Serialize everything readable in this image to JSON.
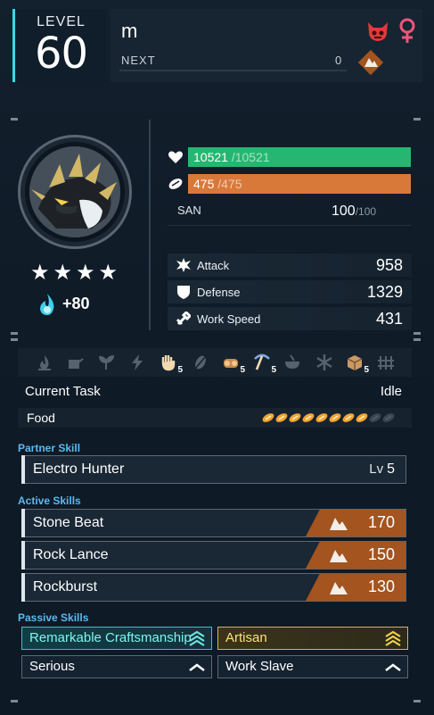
{
  "header": {
    "level_label": "LEVEL",
    "level_value": "60",
    "pal_name": "m",
    "next_label": "NEXT",
    "next_value": "0",
    "boss_icon": "boss-mask-icon",
    "gender_icon": "female-icon",
    "element_icon": "ground-element-icon",
    "accent_color": "#3fd6e6"
  },
  "portrait": {
    "stars": "★★★★",
    "soul_bonus": "+80",
    "soul_icon": "soul-flame-icon"
  },
  "vitals": {
    "hp_current": "10521",
    "hp_max": "/10521",
    "hp_color": "#27b671",
    "stamina_current": "475",
    "stamina_max": "/475",
    "stamina_color": "#d8793a",
    "san_label": "SAN",
    "san_current": "100",
    "san_max": "/100"
  },
  "stats": [
    {
      "label": "Attack",
      "value": "958",
      "icon": "attack-icon"
    },
    {
      "label": "Defense",
      "value": "1329",
      "icon": "shield-icon"
    },
    {
      "label": "Work Speed",
      "value": "431",
      "icon": "work-speed-icon"
    }
  ],
  "work_suitability": [
    {
      "icon": "kindling-icon",
      "level": ""
    },
    {
      "icon": "watering-icon",
      "level": ""
    },
    {
      "icon": "planting-icon",
      "level": ""
    },
    {
      "icon": "electricity-icon",
      "level": ""
    },
    {
      "icon": "handiwork-icon",
      "level": "5"
    },
    {
      "icon": "gathering-icon",
      "level": ""
    },
    {
      "icon": "lumbering-icon",
      "level": "5"
    },
    {
      "icon": "mining-icon",
      "level": "5"
    },
    {
      "icon": "medicine-icon",
      "level": ""
    },
    {
      "icon": "cooling-icon",
      "level": ""
    },
    {
      "icon": "transporting-icon",
      "level": "5"
    },
    {
      "icon": "farming-icon",
      "level": ""
    }
  ],
  "task": {
    "label": "Current Task",
    "value": "Idle"
  },
  "food": {
    "label": "Food",
    "filled": 8,
    "total": 10
  },
  "partner_skill": {
    "section_title": "Partner Skill",
    "name": "Electro Hunter",
    "lv_label": "Lv",
    "lv_value": "5"
  },
  "active_skills": {
    "section_title": "Active Skills",
    "items": [
      {
        "name": "Stone Beat",
        "power": "170",
        "element": "ground-element-icon"
      },
      {
        "name": "Rock Lance",
        "power": "150",
        "element": "ground-element-icon"
      },
      {
        "name": "Rockburst",
        "power": "130",
        "element": "ground-element-icon"
      }
    ]
  },
  "passive_skills": {
    "section_title": "Passive Skills",
    "items": [
      {
        "name": "Remarkable Craftsmanship",
        "rank_icon": "rank-up-triple-icon",
        "tier": "teal"
      },
      {
        "name": "Artisan",
        "rank_icon": "rank-up-triple-icon",
        "tier": "gold"
      },
      {
        "name": "Serious",
        "rank_icon": "rank-up-single-icon",
        "tier": "normal"
      },
      {
        "name": "Work Slave",
        "rank_icon": "rank-up-single-icon",
        "tier": "normal"
      }
    ]
  }
}
